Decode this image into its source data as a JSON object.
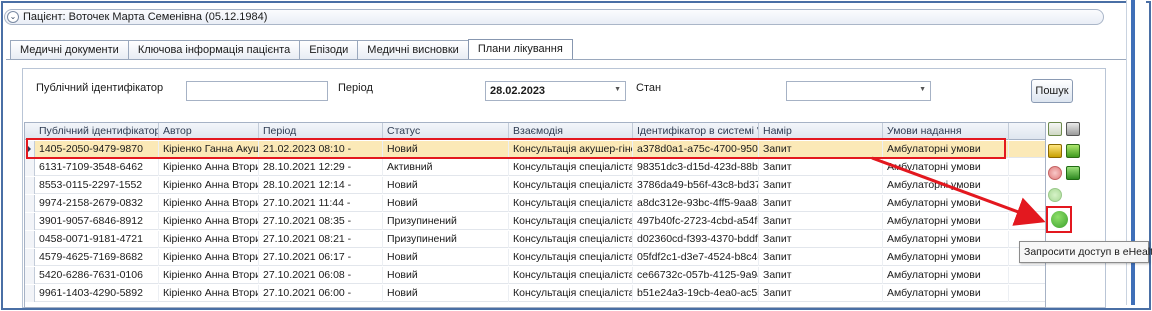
{
  "patient": {
    "chevron": "⌄",
    "label": "Пацієнт: Воточек Марта Семенівна (05.12.1984)"
  },
  "tabs": [
    {
      "label": "Медичні документи"
    },
    {
      "label": "Ключова інформація пацієнта"
    },
    {
      "label": "Епізоди"
    },
    {
      "label": "Медичні висновки"
    },
    {
      "label": "Плани лікування"
    }
  ],
  "filters": {
    "public_id_label": "Публічний ідентифікатор",
    "public_id_value": "",
    "period_label": "Період",
    "period_value": "28.02.2023",
    "state_label": "Стан",
    "state_value": "",
    "search_button": "Пошук"
  },
  "grid": {
    "columns": [
      "Публічний ідентифікатор",
      "Автор",
      "Період",
      "Статус",
      "Взаємодія",
      "Ідентифікатор в системі \"eHe",
      "Намір",
      "Умови надання"
    ],
    "rows": [
      [
        "1405-2050-9479-9870",
        "Кіріенко Ганна Акуш...",
        "21.02.2023 08:10 -",
        "Новий",
        "Консультація акушер-гінек...",
        "a378d0a1-a75c-4700-950c-...",
        "Запит",
        "Амбулаторні умови"
      ],
      [
        "6131-7109-3548-6462",
        "Кіріенко Анна Втори...",
        "28.10.2021 12:29 -",
        "Активний",
        "Консультація спеціаліста С...",
        "98351dc3-d15d-423d-88b0...",
        "Запит",
        "Амбулаторні умови"
      ],
      [
        "8553-0115-2297-1552",
        "Кіріенко Анна Втори...",
        "28.10.2021 12:14 -",
        "Новий",
        "Консультація спеціаліста С...",
        "3786da49-b56f-43c8-bd37-...",
        "Запит",
        "Амбулаторні умови"
      ],
      [
        "9974-2158-2679-0832",
        "Кіріенко Анна Втори...",
        "27.10.2021 11:44 -",
        "Новий",
        "Консультація спеціаліста С...",
        "a8dc312e-93bc-4ff5-9aa8-e...",
        "Запит",
        "Амбулаторні умови"
      ],
      [
        "3901-9057-6846-8912",
        "Кіріенко Анна Втори...",
        "27.10.2021 08:35 -",
        "Призупинений",
        "Консультація спеціаліста С...",
        "497b40fc-2723-4cbd-a54f-b...",
        "Запит",
        "Амбулаторні умови"
      ],
      [
        "0458-0071-9181-4721",
        "Кіріенко Анна Втори...",
        "27.10.2021 08:21 -",
        "Призупинений",
        "Консультація спеціаліста С...",
        "d02360cd-f393-4370-bddf-...",
        "Запит",
        "Амбулаторні умови"
      ],
      [
        "4579-4625-7169-8682",
        "Кіріенко Анна Втори...",
        "27.10.2021 06:17 -",
        "Новий",
        "Консультація спеціаліста С...",
        "05fdf2c1-d3e7-4524-b8c4-3...",
        "Запит",
        "Амбулаторні умови"
      ],
      [
        "5420-6286-7631-0106",
        "Кіріенко Анна Втори...",
        "27.10.2021 06:08 -",
        "Новий",
        "Консультація спеціаліста С...",
        "ce66732c-057b-4125-9a94-...",
        "Запит",
        "Амбулаторні умови"
      ],
      [
        "9961-1403-4290-5892",
        "Кіріенко Анна Втори...",
        "27.10.2021 06:00 -",
        "Новий",
        "Консультація спеціаліста С...",
        "b51e24a3-19cb-4ea0-ac55-...",
        "Запит",
        "Амбулаторні умови"
      ]
    ],
    "selected_row": 0
  },
  "toolbar_icons": [
    "add-document-icon",
    "tools-icon",
    "shield-icon",
    "refresh-icon",
    "cancel-icon",
    "flag-icon",
    "disabled-circle-icon",
    "request-access-icon"
  ],
  "tooltip": "Запросити доступ в eHealth",
  "colors": {
    "highlight": "#e3181f",
    "selected_row": "#fbe9b7",
    "accent": "#3f6fb8"
  }
}
